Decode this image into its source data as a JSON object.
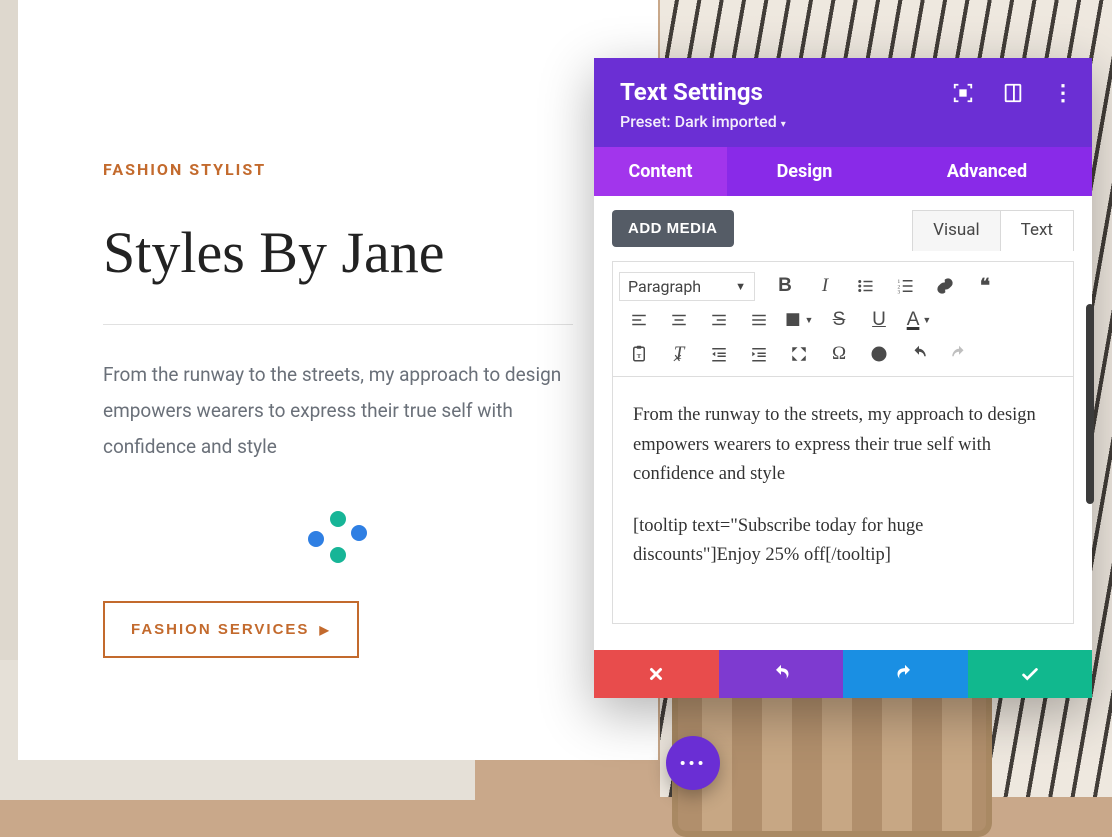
{
  "page": {
    "eyebrow": "FASHION STYLIST",
    "title": "Styles By Jane",
    "body": "From the runway to the streets, my approach to design empowers wearers to express their true self with confidence and style",
    "button": "FASHION SERVICES"
  },
  "panel": {
    "title": "Text Settings",
    "preset_label": "Preset: Dark imported",
    "tabs": {
      "content": "Content",
      "design": "Design",
      "advanced": "Advanced"
    },
    "add_media": "ADD MEDIA",
    "mode": {
      "visual": "Visual",
      "text": "Text"
    },
    "format_select": "Paragraph",
    "editor_p1": "From the runway to the streets, my approach to design empowers wearers to express their true self with confidence and style",
    "editor_p2": "[tooltip text=\"Subscribe today for huge discounts\"]Enjoy 25% off[/tooltip]"
  }
}
